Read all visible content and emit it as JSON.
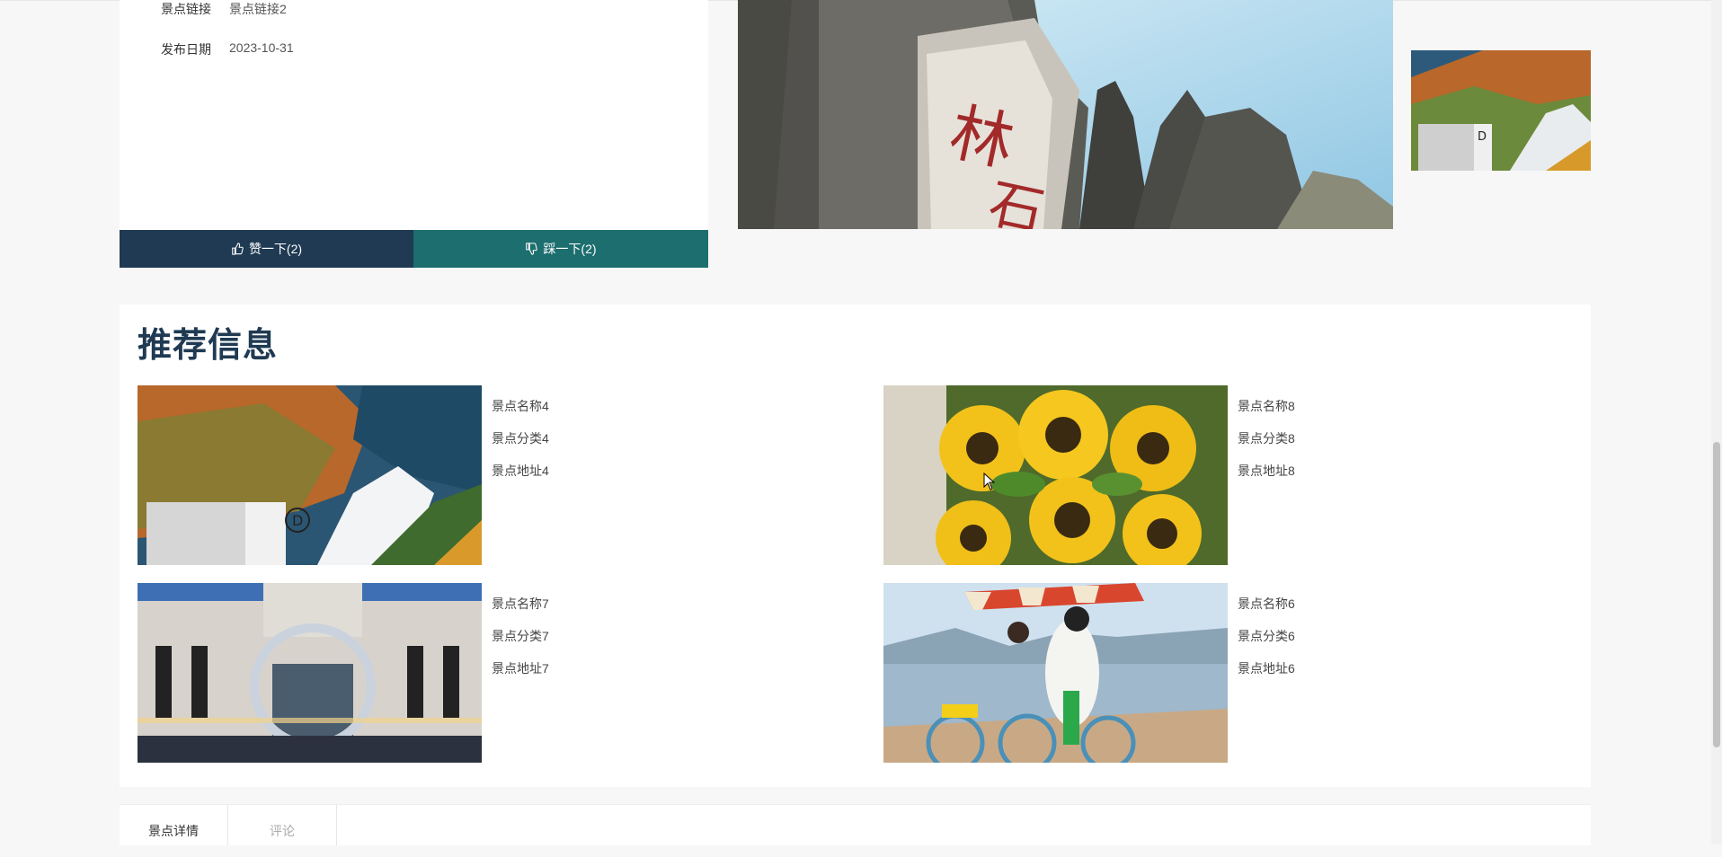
{
  "detail": {
    "link_label": "景点链接",
    "link_value": "景点链接2",
    "date_label": "发布日期",
    "date_value": "2023-10-31"
  },
  "votes": {
    "like_label": "赞一下(2)",
    "dislike_label": "踩一下(2)"
  },
  "recommend": {
    "title": "推荐信息",
    "items": [
      {
        "name": "景点名称4",
        "category": "景点分类4",
        "address": "景点地址4",
        "image": "mountain-valley"
      },
      {
        "name": "景点名称8",
        "category": "景点分类8",
        "address": "景点地址8",
        "image": "sunflowers"
      },
      {
        "name": "景点名称7",
        "category": "景点分类7",
        "address": "景点地址7",
        "image": "building-moon"
      },
      {
        "name": "景点名称6",
        "category": "景点分类6",
        "address": "景点地址6",
        "image": "bicycle-lake"
      }
    ]
  },
  "tabs": {
    "detail": "景点详情",
    "comments": "评论"
  },
  "colors": {
    "like_bg": "#1f3a52",
    "dislike_bg": "#1d6e6e",
    "title_color": "#1f3a52"
  }
}
